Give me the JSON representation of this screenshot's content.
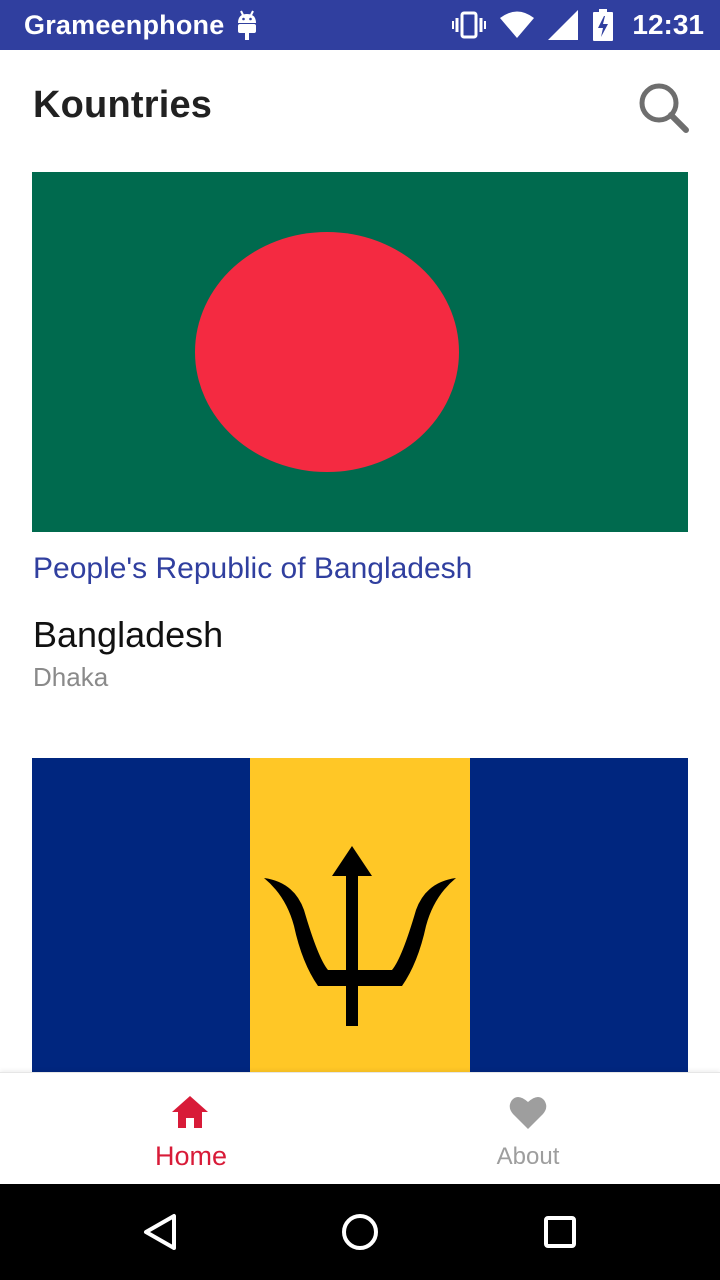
{
  "status_bar": {
    "carrier": "Grameenphone",
    "time": "12:31",
    "icons": [
      "android-debug-icon",
      "vibrate-icon",
      "wifi-icon",
      "signal-icon",
      "battery-charging-icon"
    ]
  },
  "app_bar": {
    "title": "Kountries",
    "search_icon": "search-icon"
  },
  "countries": [
    {
      "official_name": "People's Republic of Bangladesh",
      "common_name": "Bangladesh",
      "capital": "Dhaka",
      "flag": {
        "field_color": "#006a4e",
        "disc_color": "#f42a41"
      }
    },
    {
      "official_name": "",
      "common_name": "",
      "capital": "",
      "flag": {
        "outer_color": "#00267f",
        "center_color": "#ffc726",
        "emblem_color": "#000000",
        "emblem": "trident"
      }
    }
  ],
  "bottom_nav": {
    "items": [
      {
        "label": "Home",
        "icon": "home-icon",
        "selected": true,
        "color": "#d81b38"
      },
      {
        "label": "About",
        "icon": "heart-icon",
        "selected": false,
        "color": "#9e9e9e"
      }
    ]
  },
  "system_nav": {
    "buttons": [
      "back-icon",
      "home-circle-icon",
      "recents-icon"
    ]
  },
  "colors": {
    "primary": "#303f9f",
    "accent": "#d81b38"
  }
}
